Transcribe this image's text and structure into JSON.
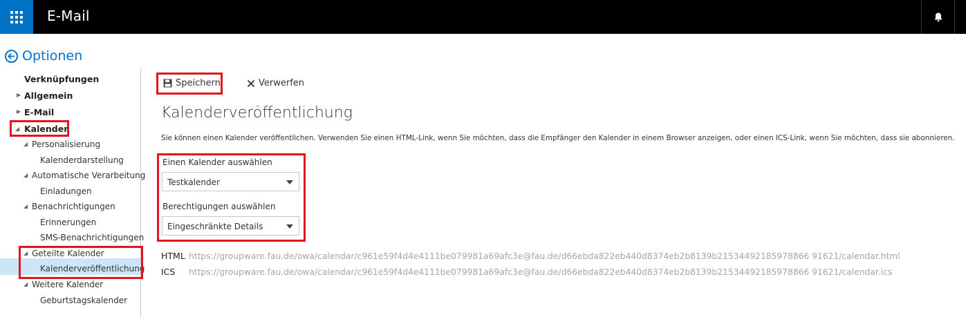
{
  "header": {
    "app_title": "E-Mail",
    "launcher_icon": "waffle-icon",
    "notification_icon": "bell-icon"
  },
  "back": {
    "label": "Optionen",
    "icon": "back-arrow-icon"
  },
  "sidebar": {
    "items": [
      {
        "label": "Verknüpfungen"
      },
      {
        "label": "Allgemein"
      },
      {
        "label": "E-Mail"
      },
      {
        "label": "Kalender"
      },
      {
        "label": "Personalisierung"
      },
      {
        "label": "Kalenderdarstellung"
      },
      {
        "label": "Automatische Verarbeitung"
      },
      {
        "label": "Einladungen"
      },
      {
        "label": "Benachrichtigungen"
      },
      {
        "label": "Erinnerungen"
      },
      {
        "label": "SMS-Benachrichtigungen"
      },
      {
        "label": "Geteilte Kalender"
      },
      {
        "label": "Kalenderveröffentlichung"
      },
      {
        "label": "Weitere Kalender"
      },
      {
        "label": "Geburtstagskalender"
      }
    ],
    "selected": "Kalenderveröffentlichung"
  },
  "toolbar": {
    "save_label": "Speichern",
    "discard_label": "Verwerfen"
  },
  "main": {
    "title": "Kalenderveröffentlichung",
    "description": "Sie können einen Kalender veröffentlichen. Verwenden Sie einen HTML-Link, wenn Sie möchten, dass die Empfänger den Kalender in einem Browser anzeigen, oder einen ICS-Link, wenn Sie möchten, dass sie abonnieren.",
    "calendar_select": {
      "label": "Einen Kalender auswählen",
      "value": "Testkalender"
    },
    "permissions_select": {
      "label": "Berechtigungen auswählen",
      "value": "Eingeschränkte Details"
    },
    "links": [
      {
        "label": "HTML",
        "url": "https://groupware.fau.de/owa/calendar/c961e59f4d4e4111be079981a69afc3e@fau.de/d66ebda822eb440d8374eb2b8139b21534492185978866 91621/calendar.html"
      },
      {
        "label": "ICS",
        "url": "https://groupware.fau.de/owa/calendar/c961e59f4d4e4111be079981a69afc3e@fau.de/d66ebda822eb440d8374eb2b8139b21534492185978866 91621/calendar.ics"
      }
    ]
  },
  "colors": {
    "accent": "#0072c6",
    "highlight": "#e3141e",
    "selected_bg": "#cde6f7"
  }
}
